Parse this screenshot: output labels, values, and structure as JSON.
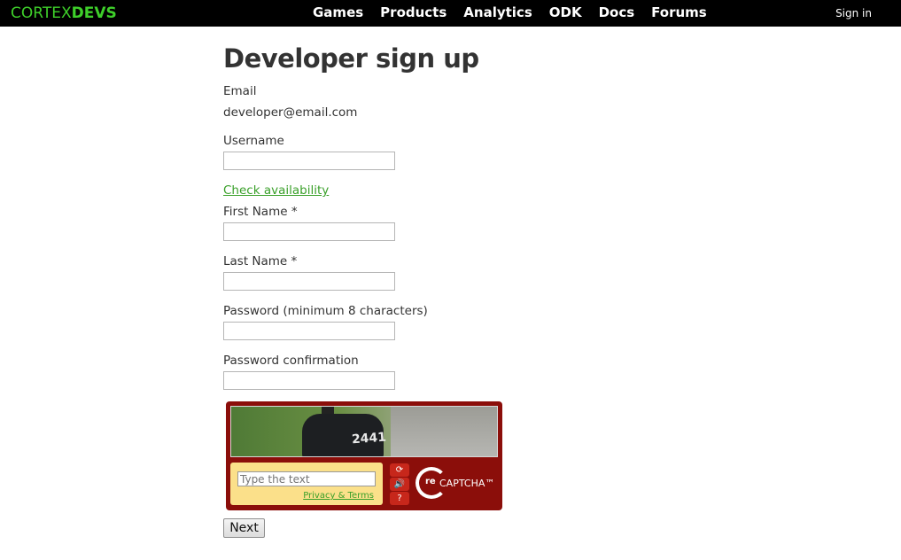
{
  "header": {
    "logo_part1": "CORTEX",
    "logo_part2": "DEVS",
    "nav": [
      "Games",
      "Products",
      "Analytics",
      "ODK",
      "Docs",
      "Forums"
    ],
    "signin": "Sign in"
  },
  "form": {
    "title": "Developer sign up",
    "email_label": "Email",
    "email_value": "developer@email.com",
    "username_label": "Username",
    "username_value": "",
    "check_availability": "Check availability",
    "first_name_label": "First Name *",
    "first_name_value": "",
    "last_name_label": "Last Name *",
    "last_name_value": "",
    "password_label": "Password (minimum 8 characters)",
    "password_value": "",
    "password_confirm_label": "Password confirmation",
    "password_confirm_value": "",
    "next_label": "Next"
  },
  "captcha": {
    "image_text": "2441",
    "input_placeholder": "Type the text",
    "privacy_terms": "Privacy & Terms",
    "logo_prefix": "re",
    "logo_word": "CAPTCHA™",
    "buttons": [
      "refresh-icon",
      "audio-icon",
      "help-icon"
    ]
  },
  "colors": {
    "brand_green": "#3ecf2a",
    "link_green": "#3aa02a",
    "captcha_red": "#8b0e0a",
    "captcha_yellow": "#fbe08a"
  }
}
